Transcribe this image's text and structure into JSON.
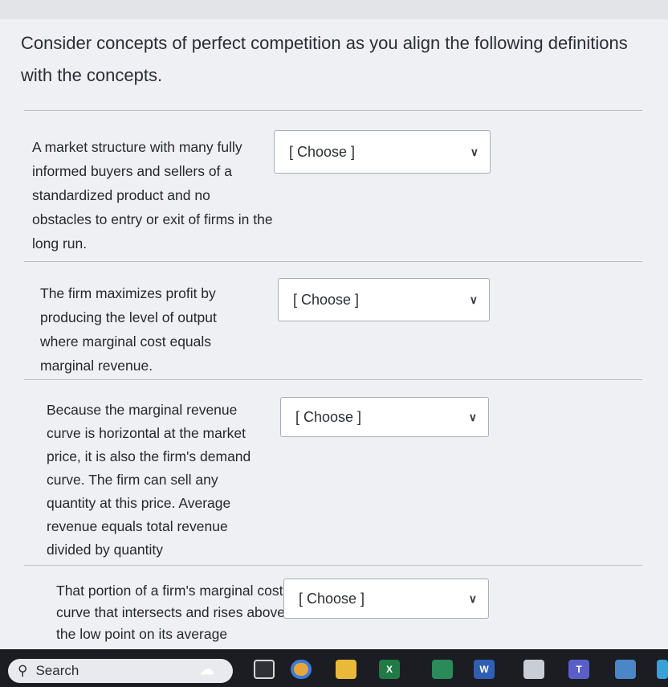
{
  "question": {
    "text": "Consider concepts of perfect competition as you align the following definitions with the concepts."
  },
  "rows": [
    {
      "definition": "A market structure with many fully informed buyers and sellers of a standardized product and no obstacles to entry or exit of firms in the long run.",
      "select_value": "[ Choose ]"
    },
    {
      "definition": "The firm maximizes profit by producing the level of output where marginal cost equals marginal revenue.",
      "select_value": "[ Choose ]"
    },
    {
      "definition": "Because the marginal revenue curve is horizontal at the market price, it is also the firm's demand curve. The firm can sell any quantity at this price. Average revenue equals total revenue divided by quantity",
      "select_value": "[ Choose ]"
    },
    {
      "definition": "That portion of a firm's marginal cost curve that intersects and rises above the low point on its average",
      "select_value": "[ Choose ]"
    }
  ],
  "taskbar": {
    "search_label": "Search",
    "icons": [
      "search-icon",
      "weather-widget-icon",
      "task-view-icon",
      "chrome-icon",
      "file-explorer-icon",
      "excel-icon",
      "app-icon",
      "word-icon",
      "remote-desktop-icon",
      "teams-icon",
      "calculator-icon",
      "edge-icon"
    ]
  }
}
